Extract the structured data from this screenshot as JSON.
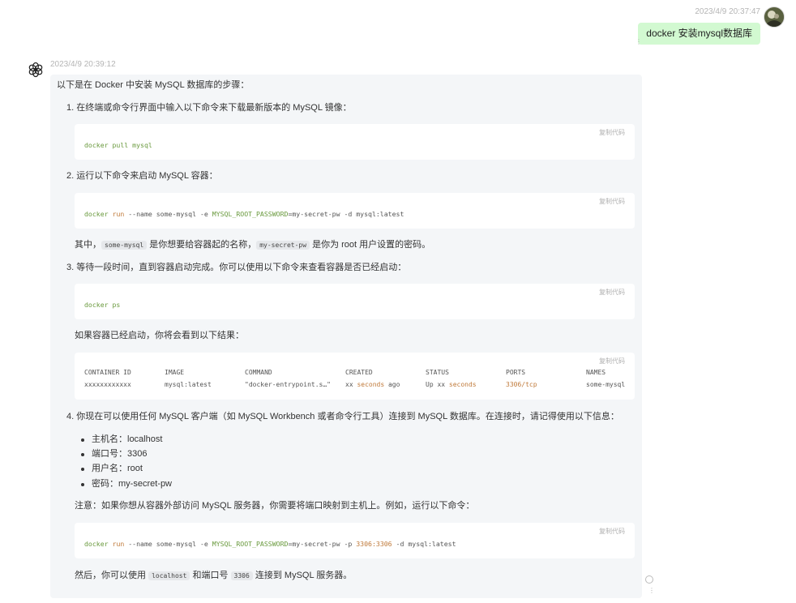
{
  "user": {
    "timestamp": "2023/4/9 20:37:47",
    "message": "docker 安装mysql数据库",
    "avatar_icon": "user-avatar-icon"
  },
  "assistant": {
    "timestamp": "2023/4/9 20:39:12",
    "avatar_icon": "openai-logo-icon",
    "intro": "以下是在 Docker 中安装 MySQL 数据库的步骤：",
    "copy_label": "复制代码",
    "step1": "1. 在终端或命令行界面中输入以下命令来下载最新版本的 MySQL 镜像：",
    "code1": "docker pull mysql",
    "step2": "2. 运行以下命令来启动 MySQL 容器：",
    "code2": {
      "a": "docker",
      "b": "run",
      "c": " --name some-mysql -e ",
      "d": "MYSQL_ROOT_PASSWORD",
      "e": "=my-secret-pw -d mysql:latest"
    },
    "note2": {
      "prefix": "其中，",
      "code_a": "some-mysql",
      "mid": " 是你想要给容器起的名称，",
      "code_b": "my-secret-pw",
      "suffix": " 是你为 root 用户设置的密码。"
    },
    "step3": "3. 等待一段时间，直到容器启动完成。你可以使用以下命令来查看容器是否已经启动：",
    "code3": "docker ps",
    "result_intro": "如果容器已经启动，你将会看到以下结果：",
    "table": {
      "headers": [
        "CONTAINER ID",
        "IMAGE",
        "COMMAND",
        "CREATED",
        "STATUS",
        "PORTS",
        "NAMES"
      ],
      "row": {
        "id": "xxxxxxxxxxxx",
        "image": "mysql:latest",
        "command": "\"docker-entrypoint.s…\"",
        "created_a": "xx ",
        "created_b": "seconds",
        "created_c": " ago",
        "status_a": "Up xx ",
        "status_b": "seconds",
        "ports": "3306/tcp",
        "names": "some-mysql"
      }
    },
    "step4": "4. 你现在可以使用任何 MySQL 客户端（如 MySQL Workbench 或者命令行工具）连接到 MySQL 数据库。在连接时，请记得使用以下信息：",
    "bullets": [
      "主机名：localhost",
      "端口号：3306",
      "用户名：root",
      "密码：my-secret-pw"
    ],
    "note4": "注意：如果你想从容器外部访问 MySQL 服务器，你需要将端口映射到主机上。例如，运行以下命令：",
    "code4": {
      "a": "docker",
      "b": "run",
      "c": " --name some-mysql -e ",
      "d": "MYSQL_ROOT_PASSWORD",
      "e": "=my-secret-pw -p ",
      "f": "3306:3306",
      "g": " -d mysql:latest"
    },
    "final": {
      "prefix": "然后，你可以使用 ",
      "code_a": "localhost",
      "mid": " 和端口号 ",
      "code_b": "3306",
      "suffix": " 连接到 MySQL 服务器。"
    }
  }
}
